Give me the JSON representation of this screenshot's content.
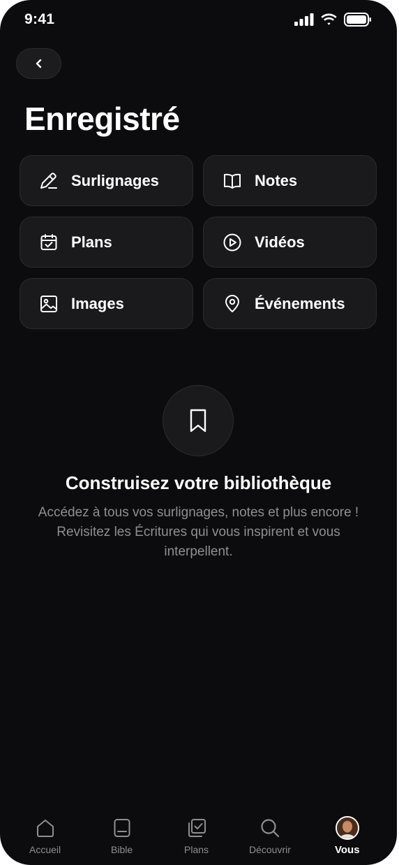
{
  "status_bar": {
    "time": "9:41"
  },
  "header": {
    "title": "Enregistré"
  },
  "categories": [
    {
      "label": "Surlignages",
      "icon": "highlighter-icon"
    },
    {
      "label": "Notes",
      "icon": "book-icon"
    },
    {
      "label": "Plans",
      "icon": "calendar-check-icon"
    },
    {
      "label": "Vidéos",
      "icon": "play-circle-icon"
    },
    {
      "label": "Images",
      "icon": "image-icon"
    },
    {
      "label": "Événements",
      "icon": "map-pin-icon"
    }
  ],
  "empty_state": {
    "icon": "bookmark-icon",
    "title": "Construisez votre bibliothèque",
    "description": "Accédez à tous vos surlignages, notes et plus encore ! Revisitez les Écritures qui vous inspirent et vous interpellent."
  },
  "tabs": [
    {
      "label": "Accueil",
      "icon": "home-icon"
    },
    {
      "label": "Bible",
      "icon": "bible-icon"
    },
    {
      "label": "Plans",
      "icon": "plans-icon"
    },
    {
      "label": "Découvrir",
      "icon": "search-icon"
    },
    {
      "label": "Vous",
      "icon": "avatar",
      "active": true
    }
  ],
  "colors": {
    "background": "#0c0c0e",
    "card": "#1a1a1d",
    "muted_text": "#8f8f94"
  }
}
